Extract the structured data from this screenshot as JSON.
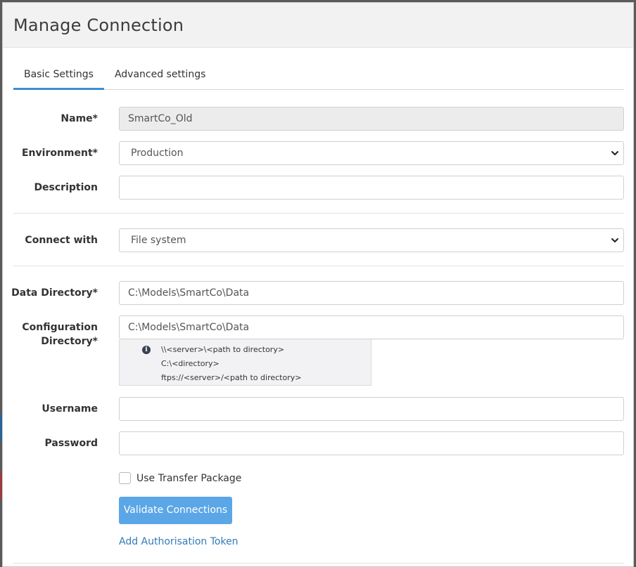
{
  "modal": {
    "title": "Manage Connection"
  },
  "tabs": [
    {
      "label": "Basic Settings",
      "active": true
    },
    {
      "label": "Advanced settings",
      "active": false
    }
  ],
  "form": {
    "name": {
      "label": "Name*",
      "value": "SmartCo_Old",
      "disabled": true
    },
    "environment": {
      "label": "Environment*",
      "value": "Production"
    },
    "description": {
      "label": "Description",
      "value": ""
    },
    "connect_with": {
      "label": "Connect with",
      "value": "File system"
    },
    "data_directory": {
      "label": "Data Directory*",
      "value": "C:\\Models\\SmartCo\\Data"
    },
    "config_directory": {
      "label_line1": "Configuration",
      "label_line2": "Directory*",
      "value": "C:\\Models\\SmartCo\\Data",
      "help_lines": [
        "\\\\<server>\\<path to directory>",
        "C:\\<directory>",
        "ftps://<server>/<path to directory>"
      ]
    },
    "username": {
      "label": "Username",
      "value": ""
    },
    "password": {
      "label": "Password",
      "value": ""
    },
    "use_transfer_package": {
      "label": "Use Transfer Package",
      "checked": false
    },
    "validate_button": "Validate Connections",
    "auth_link": "Add Authorisation Token"
  },
  "icons": {
    "info": "info-icon",
    "select": "chevron-down-icon"
  },
  "colors": {
    "accent": "#3d8fd4",
    "button": "#5ba6e6",
    "link": "#337ab7"
  }
}
